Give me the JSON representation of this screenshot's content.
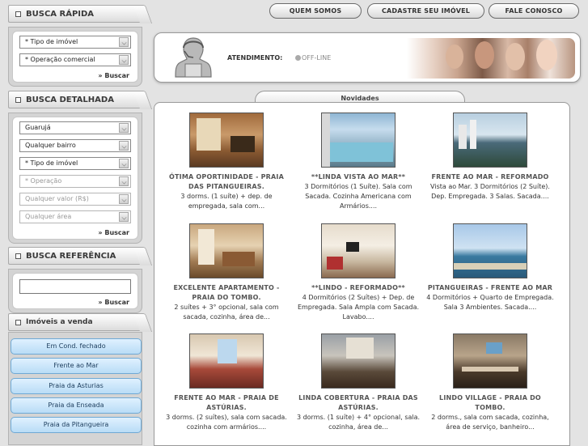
{
  "nav": {
    "quem_somos": "QUEM SOMOS",
    "cadastre": "CADASTRE SEU IMÓVEL",
    "fale": "FALE CONOSCO"
  },
  "busca_rapida": {
    "title": "BUSCA RÁPIDA",
    "tipo": "* Tipo de imóvel",
    "operacao": "* Operação comercial",
    "buscar": "» Buscar"
  },
  "busca_detalhada": {
    "title": "BUSCA DETALHADA",
    "cidade": "Guarujá",
    "bairro": "Qualquer bairro",
    "tipo": "* Tipo de imóvel",
    "operacao": "* Operação",
    "valor": "Qualquer valor (R$)",
    "area": "Qualquer área",
    "buscar": "» Buscar"
  },
  "busca_referencia": {
    "title": "BUSCA REFERÊNCIA",
    "buscar": "» Buscar"
  },
  "imoveis": {
    "title": "Imóveis a venda",
    "items": [
      "Em Cond. fechado",
      "Frente ao Mar",
      "Praia da Asturias",
      "Praia da Enseada",
      "Praia da Pitangueira"
    ]
  },
  "atendimento": {
    "label": "ATENDIMENTO:",
    "status": "OFF-LINE"
  },
  "novidades": {
    "title": "Novidades",
    "listings": [
      {
        "title": "ÓTIMA OPORTINIDADE - PRAIA DAS PITANGUEIRAS.",
        "desc": "3 dorms. (1 suíte) + dep. de empregada, sala com..."
      },
      {
        "title": "**LINDA VISTA AO MAR**",
        "desc": "3 Dormitórios (1 Suíte). Sala com Sacada. Cozinha Americana com Armários...."
      },
      {
        "title": "FRENTE AO MAR - REFORMADO",
        "desc": "Vista ao Mar. 3 Dormitórios (2 Suíte). Dep. Empregada. 3 Salas. Sacada...."
      },
      {
        "title": "EXCELENTE APARTAMENTO - PRAIA DO TOMBO.",
        "desc": "2 suítes + 3° opcional, sala com sacada, cozinha, área de..."
      },
      {
        "title": "**LINDO - REFORMADO**",
        "desc": "4 Dormitórios (2 Suítes) + Dep. de Empregada. Sala Ampla com Sacada. Lavabo...."
      },
      {
        "title": "PITANGUEIRAS - FRENTE AO MAR",
        "desc": "4 Dormitórios + Quarto de Empregada. Sala 3 Ambientes. Sacada...."
      },
      {
        "title": "FRENTE AO MAR - PRAIA DE ASTÚRIAS.",
        "desc": "3 dorms. (2 suítes), sala com sacada. cozinha com armários...."
      },
      {
        "title": "LINDA COBERTURA - PRAIA DAS ASTÚRIAS.",
        "desc": "3 dorms. (1 suíte) + 4° opcional, sala. cozinha, área de..."
      },
      {
        "title": "LINDO VILLAGE - PRAIA DO TOMBO.",
        "desc": "2 dorms., sala com sacada, cozinha, área de serviço, banheiro..."
      }
    ]
  }
}
